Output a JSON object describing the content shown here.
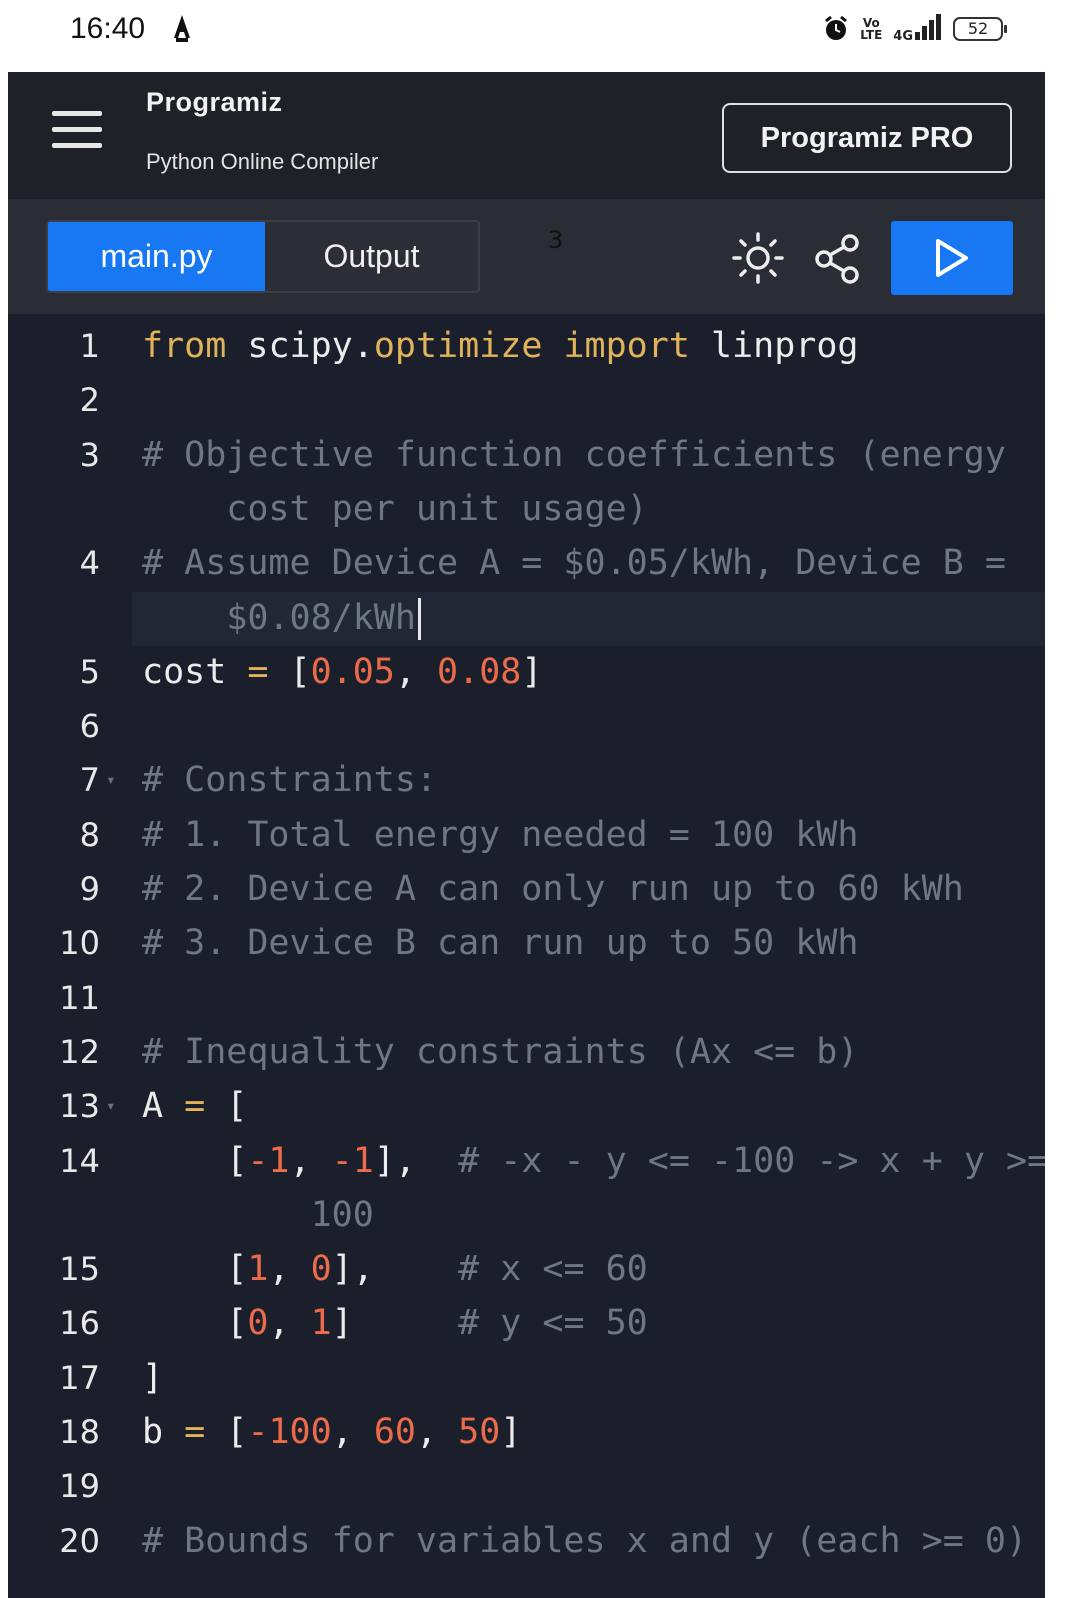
{
  "status_bar": {
    "time": "16:40",
    "network": "Vo LTE",
    "signal": "4G",
    "battery": "52"
  },
  "header": {
    "logo": "Programiz",
    "subtitle": "Python Online Compiler",
    "pro_button": "Programiz PRO"
  },
  "tabs": {
    "main": "main.py",
    "output": "Output"
  },
  "overlay_text": "3",
  "editor": {
    "lines": [
      {
        "n": "1",
        "tokens": [
          [
            "kw",
            "from"
          ],
          [
            "txt",
            " scipy."
          ],
          [
            "kw",
            "optimize"
          ],
          [
            "txt",
            " "
          ],
          [
            "kw",
            "import"
          ],
          [
            "txt",
            " linprog"
          ]
        ]
      },
      {
        "n": "2",
        "tokens": []
      },
      {
        "n": "3",
        "tokens": [
          [
            "cm",
            "# Objective function coefficients (energy"
          ]
        ]
      },
      {
        "n": "",
        "tokens": [
          [
            "cm",
            "    cost per unit usage)"
          ]
        ]
      },
      {
        "n": "4",
        "tokens": [
          [
            "cm",
            "# Assume Device A = $0.05/kWh, Device B ="
          ]
        ]
      },
      {
        "n": "",
        "tokens": [
          [
            "cm",
            "    $0.08/kWh"
          ]
        ],
        "caret": true,
        "highlight": true
      },
      {
        "n": "5",
        "tokens": [
          [
            "txt",
            "cost "
          ],
          [
            "op",
            "="
          ],
          [
            "txt",
            " ["
          ],
          [
            "num",
            "0.05"
          ],
          [
            "txt",
            ", "
          ],
          [
            "num",
            "0.08"
          ],
          [
            "txt",
            "]"
          ]
        ]
      },
      {
        "n": "6",
        "tokens": []
      },
      {
        "n": "7",
        "fold": true,
        "tokens": [
          [
            "cm",
            "# Constraints:"
          ]
        ]
      },
      {
        "n": "8",
        "tokens": [
          [
            "cm",
            "# 1. Total energy needed = 100 kWh"
          ]
        ]
      },
      {
        "n": "9",
        "tokens": [
          [
            "cm",
            "# 2. Device A can only run up to 60 kWh"
          ]
        ]
      },
      {
        "n": "10",
        "tokens": [
          [
            "cm",
            "# 3. Device B can run up to 50 kWh"
          ]
        ]
      },
      {
        "n": "11",
        "tokens": []
      },
      {
        "n": "12",
        "tokens": [
          [
            "cm",
            "# Inequality constraints (Ax <= b)"
          ]
        ]
      },
      {
        "n": "13",
        "fold": true,
        "tokens": [
          [
            "txt",
            "A "
          ],
          [
            "op",
            "="
          ],
          [
            "txt",
            " ["
          ]
        ]
      },
      {
        "n": "14",
        "tokens": [
          [
            "txt",
            "    ["
          ],
          [
            "num",
            "-1"
          ],
          [
            "txt",
            ", "
          ],
          [
            "num",
            "-1"
          ],
          [
            "txt",
            "],  "
          ],
          [
            "cm",
            "# -x - y <= -100 -> x + y >="
          ]
        ]
      },
      {
        "n": "",
        "tokens": [
          [
            "cm",
            "        100"
          ]
        ]
      },
      {
        "n": "15",
        "tokens": [
          [
            "txt",
            "    ["
          ],
          [
            "num",
            "1"
          ],
          [
            "txt",
            ", "
          ],
          [
            "num",
            "0"
          ],
          [
            "txt",
            "],    "
          ],
          [
            "cm",
            "# x <= 60"
          ]
        ]
      },
      {
        "n": "16",
        "tokens": [
          [
            "txt",
            "    ["
          ],
          [
            "num",
            "0"
          ],
          [
            "txt",
            ", "
          ],
          [
            "num",
            "1"
          ],
          [
            "txt",
            "]     "
          ],
          [
            "cm",
            "# y <= 50"
          ]
        ]
      },
      {
        "n": "17",
        "tokens": [
          [
            "txt",
            "]"
          ]
        ]
      },
      {
        "n": "18",
        "tokens": [
          [
            "txt",
            "b "
          ],
          [
            "op",
            "="
          ],
          [
            "txt",
            " ["
          ],
          [
            "num",
            "-100"
          ],
          [
            "txt",
            ", "
          ],
          [
            "num",
            "60"
          ],
          [
            "txt",
            ", "
          ],
          [
            "num",
            "50"
          ],
          [
            "txt",
            "]"
          ]
        ]
      },
      {
        "n": "19",
        "tokens": []
      },
      {
        "n": "20",
        "tokens": [
          [
            "cm",
            "# Bounds for variables x and y (each >= 0)"
          ]
        ]
      }
    ]
  }
}
